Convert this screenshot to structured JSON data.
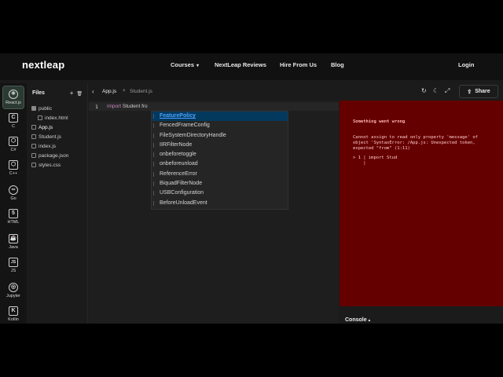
{
  "nav": {
    "logo": "nextleap",
    "links": [
      {
        "label": "Courses",
        "caret": "▾"
      },
      {
        "label": "NextLeap Reviews"
      },
      {
        "label": "Hire From Us"
      },
      {
        "label": "Blog"
      },
      {
        "label": "Login"
      }
    ]
  },
  "rail": {
    "items": [
      {
        "label": "React.js",
        "glyph": "⚛",
        "active": true
      },
      {
        "label": "C",
        "glyph": "C"
      },
      {
        "label": "C#",
        "glyph": "⬡"
      },
      {
        "label": "C++",
        "glyph": "⬡"
      },
      {
        "label": "Go",
        "glyph": "∞"
      },
      {
        "label": "HTML",
        "glyph": "5"
      },
      {
        "label": "Java",
        "glyph": "☕"
      },
      {
        "label": "JS",
        "glyph": "JS"
      },
      {
        "label": "Jupyter",
        "glyph": "◎"
      },
      {
        "label": "Kotlin",
        "glyph": "K"
      }
    ]
  },
  "files": {
    "title": "Files",
    "add_icon": "+",
    "delete_icon": "🗑",
    "tree": [
      {
        "name": "public",
        "type": "folder",
        "indent": false
      },
      {
        "name": "index.html",
        "type": "file",
        "indent": true
      },
      {
        "name": "App.js",
        "type": "file",
        "indent": false,
        "selected": true
      },
      {
        "name": "Student.js",
        "type": "file",
        "indent": false
      },
      {
        "name": "index.js",
        "type": "file",
        "indent": false
      },
      {
        "name": "package.json",
        "type": "file",
        "indent": false
      },
      {
        "name": "styles.css",
        "type": "file",
        "indent": false
      }
    ]
  },
  "editor": {
    "back": "‹",
    "active_tab": "App.js",
    "close": "×",
    "inactive_tab": "Student.js",
    "line_number": "1",
    "code_kw": "import",
    "code_rest": " Student fro"
  },
  "suggestions": [
    {
      "pre": "",
      "hl": "F",
      "mid": "eatu",
      "hl2": "r",
      "rest": "ePolicy",
      "full": "FeaturePolicy",
      "selected": true
    },
    {
      "full": "FencedFrameConfig"
    },
    {
      "full": "FileSystemDirectoryHandle"
    },
    {
      "full": "IIRFilterNode"
    },
    {
      "full": "onbeforetoggle"
    },
    {
      "full": "onbeforeunload"
    },
    {
      "full": "ReferenceError"
    },
    {
      "full": "BiquadFilterNode"
    },
    {
      "full": "USBConfiguration"
    },
    {
      "full": "BeforeUnloadEvent"
    }
  ],
  "toolbar": {
    "refresh_icon": "↻",
    "theme_icon": "☾",
    "expand_icon": "⤢",
    "share_icon": "⇪",
    "share_label": "Share"
  },
  "preview": {
    "error_title": "Something went wrong",
    "error_message": "Cannot assign to read only property 'message' of\nobject 'SyntaxError: /App.js: Unexpected token,\nexpected \"from\" (1:11)",
    "error_code": "> 1 | import Stud\n    |"
  },
  "console": {
    "label": "Console",
    "caret": "▴"
  },
  "colors": {
    "accent_blue": "#4aa3ff",
    "error_bg": "#650000",
    "selected_suggestion": "#04395e"
  }
}
